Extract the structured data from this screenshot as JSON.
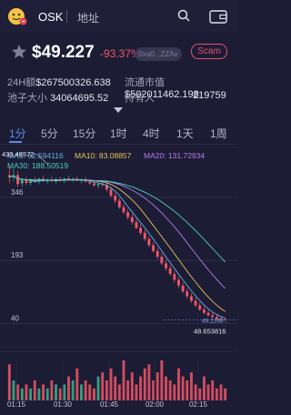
{
  "header": {
    "token_name": "OSK",
    "address_label": "地址",
    "logo_icon": "face-emoji-icon",
    "search_icon": "search-icon",
    "wallet_icon": "wallet-icon"
  },
  "price_row": {
    "price": "$49.227",
    "change": "-93.37%",
    "address_short": "0xa0...ZZAv",
    "scam_label": "Scam"
  },
  "stats": {
    "volume_24h_label": "24H额",
    "volume_24h_value": "$267500326.638",
    "circulation_label": "流通市值",
    "circulation_value": "$502011462.198",
    "pool_label": "池子大小",
    "pool_value": "34064695.52",
    "holders_label": "持有人",
    "holders_value": "219759"
  },
  "tabs": [
    "1分",
    "5分",
    "15分",
    "1时",
    "4时",
    "1天",
    "1周"
  ],
  "active_tab": "1分",
  "ma": {
    "ma5": "MA5: 62.594116",
    "ma10": "MA10: 83.08857",
    "ma20": "MA20: 131.72934",
    "ma30": "MA30: 188.50519"
  },
  "colors": {
    "up": "#3bb38a",
    "down": "#f25668",
    "ma5": "#5fb3e6",
    "ma10": "#e8c35a",
    "ma20": "#b67de8",
    "ma30": "#4ad1c0",
    "accent": "#5b8ee6"
  },
  "chart_data": {
    "type": "candlestick",
    "y_axis_ticks": [
      "346",
      "193",
      "40"
    ],
    "high_label": "435.48572",
    "low_label": "48.653816",
    "last_price_label": "49.2268...",
    "x_ticks": [
      "01:15",
      "01:30",
      "01:45",
      "02:00",
      "02:15"
    ],
    "ylim": [
      30,
      445
    ],
    "candles": [
      [
        400,
        420,
        380,
        395
      ],
      [
        395,
        415,
        385,
        400
      ],
      [
        400,
        410,
        370,
        378
      ],
      [
        380,
        392,
        372,
        388
      ],
      [
        388,
        396,
        376,
        381
      ],
      [
        381,
        392,
        374,
        389
      ],
      [
        389,
        396,
        381,
        384
      ],
      [
        384,
        394,
        378,
        391
      ],
      [
        391,
        398,
        384,
        385
      ],
      [
        385,
        392,
        379,
        389
      ],
      [
        389,
        396,
        383,
        386
      ],
      [
        386,
        394,
        380,
        390
      ],
      [
        390,
        396,
        385,
        387
      ],
      [
        387,
        393,
        381,
        392
      ],
      [
        392,
        398,
        387,
        388
      ],
      [
        388,
        394,
        383,
        391
      ],
      [
        391,
        397,
        386,
        386
      ],
      [
        386,
        392,
        380,
        389
      ],
      [
        389,
        395,
        383,
        384
      ],
      [
        384,
        390,
        377,
        380
      ],
      [
        380,
        386,
        372,
        375
      ],
      [
        375,
        383,
        368,
        378
      ],
      [
        378,
        384,
        371,
        376
      ],
      [
        376,
        382,
        360,
        365
      ],
      [
        365,
        372,
        345,
        350
      ],
      [
        350,
        358,
        332,
        338
      ],
      [
        338,
        345,
        318,
        322
      ],
      [
        322,
        330,
        305,
        310
      ],
      [
        310,
        318,
        292,
        298
      ],
      [
        298,
        306,
        280,
        286
      ],
      [
        286,
        294,
        268,
        272
      ],
      [
        272,
        282,
        255,
        260
      ],
      [
        260,
        268,
        240,
        245
      ],
      [
        245,
        252,
        225,
        230
      ],
      [
        230,
        238,
        212,
        216
      ],
      [
        216,
        224,
        196,
        202
      ],
      [
        202,
        210,
        182,
        186
      ],
      [
        186,
        195,
        168,
        174
      ],
      [
        174,
        182,
        156,
        160
      ],
      [
        160,
        168,
        140,
        146
      ],
      [
        146,
        154,
        126,
        132
      ],
      [
        132,
        140,
        114,
        118
      ],
      [
        118,
        126,
        100,
        106
      ],
      [
        106,
        114,
        90,
        95
      ],
      [
        95,
        104,
        80,
        84
      ],
      [
        84,
        92,
        70,
        74
      ],
      [
        74,
        82,
        62,
        66
      ],
      [
        66,
        74,
        56,
        60
      ],
      [
        60,
        68,
        52,
        56
      ],
      [
        56,
        63,
        48.6,
        52
      ],
      [
        52,
        58,
        48.6,
        50
      ],
      [
        50,
        54,
        48.6,
        49.2
      ]
    ],
    "volumes": [
      9,
      5,
      4,
      3,
      4,
      3,
      5,
      3,
      4,
      3,
      5,
      4,
      3,
      4,
      6,
      5,
      8,
      4,
      5,
      4,
      3,
      6,
      7,
      5,
      8,
      6,
      4,
      10,
      5,
      7,
      4,
      6,
      8,
      9,
      5,
      7,
      10,
      6,
      5,
      4,
      8,
      6,
      5,
      7,
      4,
      3,
      6,
      4,
      5,
      3,
      4,
      3
    ]
  }
}
